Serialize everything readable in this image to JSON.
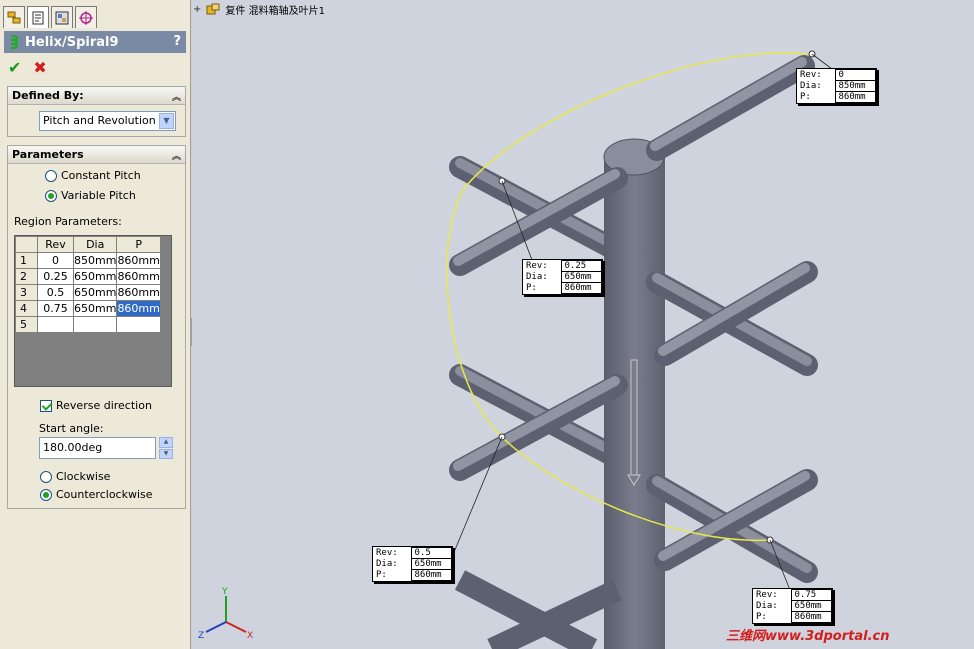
{
  "property_manager": {
    "title": "Helix/Spiral9",
    "help": "?",
    "ok_icon": "check-icon",
    "cancel_icon": "x-icon",
    "defined_by": {
      "label": "Defined By:",
      "value": "Pitch and Revolution"
    },
    "parameters": {
      "label": "Parameters",
      "constant_pitch": "Constant Pitch",
      "variable_pitch": "Variable Pitch",
      "selected": "Variable Pitch",
      "region_label": "Region Parameters:",
      "columns": [
        "Rev",
        "Dia",
        "P"
      ],
      "rows": [
        {
          "n": "1",
          "rev": "0",
          "dia": "850mm",
          "p": "860mm"
        },
        {
          "n": "2",
          "rev": "0.25",
          "dia": "650mm",
          "p": "860mm"
        },
        {
          "n": "3",
          "rev": "0.5",
          "dia": "650mm",
          "p": "860mm"
        },
        {
          "n": "4",
          "rev": "0.75",
          "dia": "650mm",
          "p": "860mm"
        },
        {
          "n": "5",
          "rev": "",
          "dia": "",
          "p": ""
        }
      ],
      "reverse_direction": "Reverse direction",
      "reverse_checked": true,
      "start_angle_label": "Start angle:",
      "start_angle": "180.00deg",
      "clockwise": "Clockwise",
      "counterclockwise": "Counterclockwise",
      "direction_selected": "Counterclockwise"
    }
  },
  "tree": {
    "expander": "+",
    "node_label": "复件 混料箱轴及叶片1"
  },
  "callouts": [
    {
      "rev": "0",
      "dia": "850mm",
      "p": "860mm"
    },
    {
      "rev": "0.25",
      "dia": "650mm",
      "p": "860mm"
    },
    {
      "rev": "0.5",
      "dia": "650mm",
      "p": "860mm"
    },
    {
      "rev": "0.75",
      "dia": "650mm",
      "p": "860mm"
    }
  ],
  "callout_labels": {
    "rev": "Rev:",
    "dia": "Dia:",
    "p": "P:"
  },
  "triad": {
    "x": "X",
    "y": "Y",
    "z": "Z"
  },
  "watermark": "三维网www.3dportal.cn",
  "colors": {
    "helix": "#e8e84a",
    "shaft": "#6e7180",
    "background": "#cfd3dd",
    "header": "#7a8aa5"
  }
}
